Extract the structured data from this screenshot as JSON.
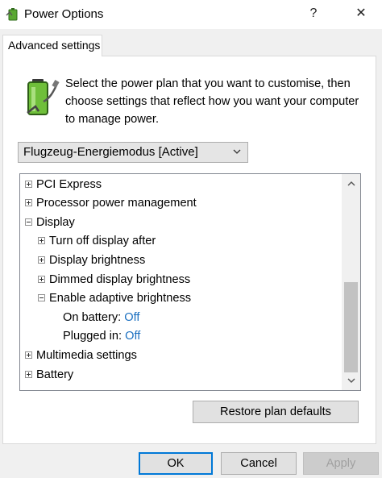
{
  "window": {
    "title": "Power Options",
    "help_glyph": "?",
    "close_glyph": "✕"
  },
  "tab": {
    "label": "Advanced settings"
  },
  "description": "Select the power plan that you want to customise, then choose settings that reflect how you want your computer to manage power.",
  "plan_select": {
    "value": "Flugzeug-Energiemodus [Active]"
  },
  "tree": {
    "pci_express": "PCI Express",
    "processor_power": "Processor power management",
    "display": "Display",
    "turn_off_display": "Turn off display after",
    "display_brightness": "Display brightness",
    "dimmed_brightness": "Dimmed display brightness",
    "adaptive_brightness": "Enable adaptive brightness",
    "on_battery_label": "On battery:",
    "on_battery_value": "Off",
    "plugged_in_label": "Plugged in:",
    "plugged_in_value": "Off",
    "multimedia": "Multimedia settings",
    "battery": "Battery"
  },
  "buttons": {
    "restore": "Restore plan defaults",
    "ok": "OK",
    "cancel": "Cancel",
    "apply": "Apply"
  },
  "colors": {
    "value_link": "#1a6fc0",
    "accent_focus": "#0078d7"
  }
}
